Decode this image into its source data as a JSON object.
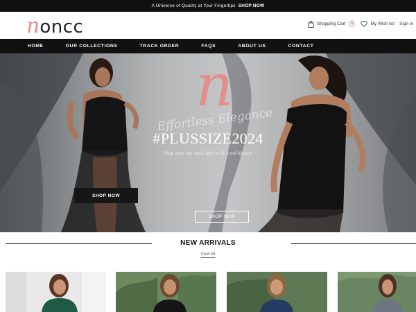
{
  "announcement": {
    "text": "A Universe of Quality at Your Fingertips",
    "link": "SHOP NOW"
  },
  "header": {
    "logo_initial": "n",
    "logo_rest": "oncc",
    "cart_label": "Shopping Cart",
    "cart_count": "0",
    "wishlist_label": "My Wish list",
    "signin_label": "Sign in"
  },
  "nav": {
    "items": [
      {
        "label": "HOME"
      },
      {
        "label": "OUR COLLECTIONS"
      },
      {
        "label": "TRACK ORDER"
      },
      {
        "label": "FAQS"
      },
      {
        "label": "ABOUT US"
      },
      {
        "label": "CONTACT"
      }
    ]
  },
  "hero": {
    "brand_mark": "n",
    "script": "Effortless Elegance",
    "title": "#PLUSSIZE2024",
    "subtitle": "Step into the spotlight with confidence",
    "primary_button": "SHOP NOW",
    "secondary_button": "SHOP NOW"
  },
  "new_arrivals": {
    "title": "NEW ARRIVALS",
    "view_all": "View All"
  },
  "products": [
    {
      "dress_color": "#1f5a45",
      "bg": "#e9e9ea",
      "hair": "#5a3424"
    },
    {
      "dress_color": "#151515",
      "bg": "#6c8a5e",
      "hair": "#6b4a31"
    },
    {
      "dress_color": "#253b63",
      "bg": "#5d7a55",
      "hair": "#8a6a44"
    },
    {
      "dress_color": "#6d7580",
      "bg": "#7d9a73",
      "hair": "#4e3022"
    }
  ],
  "colors": {
    "accent_pink": "#e48f8f",
    "nav_bg": "#111111"
  }
}
